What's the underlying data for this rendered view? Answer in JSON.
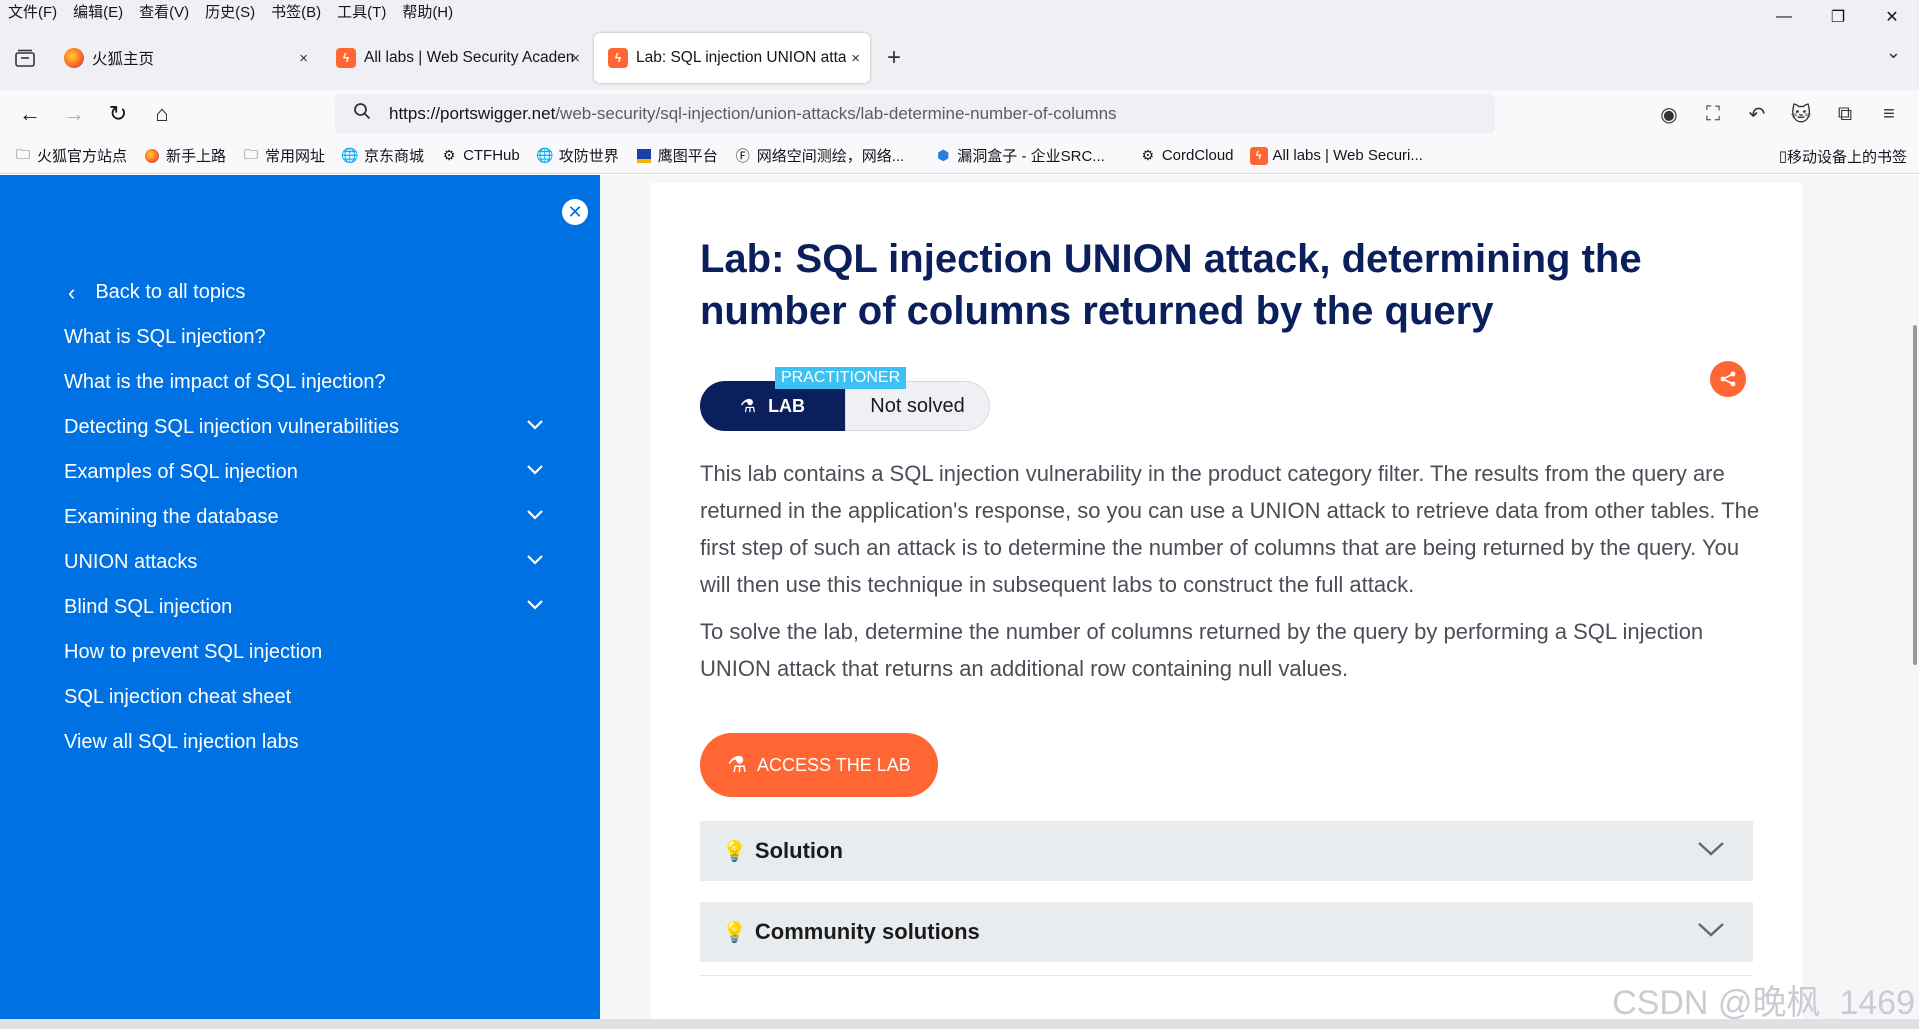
{
  "menubar": {
    "items": [
      "文件(F)",
      "编辑(E)",
      "查看(V)",
      "历史(S)",
      "书签(B)",
      "工具(T)",
      "帮助(H)"
    ]
  },
  "tabs": [
    {
      "label": "火狐主页",
      "close": "×"
    },
    {
      "label": "All labs | Web Security Academ",
      "close": "×"
    },
    {
      "label": "Lab: SQL injection UNION atta",
      "close": "×"
    }
  ],
  "navbar": {
    "url_host": "https://portswigger.net",
    "url_path": "/web-security/sql-injection/union-attacks/lab-determine-number-of-columns"
  },
  "bookmarks": [
    {
      "label": "火狐官方站点",
      "icon": "folder-icon"
    },
    {
      "label": "新手上路",
      "icon": "firefox-icon"
    },
    {
      "label": "常用网址",
      "icon": "folder-icon"
    },
    {
      "label": "京东商城",
      "icon": "globe-icon"
    },
    {
      "label": "CTFHub",
      "icon": "ctfhub-icon"
    },
    {
      "label": "攻防世界",
      "icon": "globe-icon"
    },
    {
      "label": "鹰图平台",
      "icon": "hunter-icon"
    },
    {
      "label": "网络空间测绘，网络...",
      "icon": "fofa-icon"
    },
    {
      "label": "漏洞盒子 - 企业SRC...",
      "icon": "vulbox-icon"
    },
    {
      "label": "CordCloud",
      "icon": "cordcloud-icon"
    },
    {
      "label": "All labs | Web Securi...",
      "icon": "portswigger-icon"
    }
  ],
  "bookmarks_mobile": "移动设备上的书签",
  "sidebar": {
    "back": "Back to all topics",
    "items": [
      {
        "label": "What is SQL injection?",
        "expandable": false
      },
      {
        "label": "What is the impact of SQL injection?",
        "expandable": false
      },
      {
        "label": "Detecting SQL injection vulnerabilities",
        "expandable": true
      },
      {
        "label": "Examples of SQL injection",
        "expandable": true
      },
      {
        "label": "Examining the database",
        "expandable": true
      },
      {
        "label": "UNION attacks",
        "expandable": true
      },
      {
        "label": "Blind SQL injection",
        "expandable": true
      },
      {
        "label": "How to prevent SQL injection",
        "expandable": false
      },
      {
        "label": "SQL injection cheat sheet",
        "expandable": false
      },
      {
        "label": "View all SQL injection labs",
        "expandable": false
      }
    ]
  },
  "lab": {
    "title": "Lab: SQL injection UNION attack, determining the number of columns returned by the query",
    "level": "PRACTITIONER",
    "badge": "LAB",
    "status": "Not solved",
    "description": [
      "This lab contains a SQL injection vulnerability in the product category filter. The results from the query are returned in the application's response, so you can use a UNION attack to retrieve data from other tables. The first step of such an attack is to determine the number of columns that are being returned by the query. You will then use this technique in subsequent labs to construct the full attack.",
      "To solve the lab, determine the number of columns returned by the query by performing a SQL injection UNION attack that returns an additional row containing null values."
    ],
    "access_button": "ACCESS THE LAB",
    "accordions": [
      "Solution",
      "Community solutions"
    ]
  },
  "watermark": "CSDN @晚枫_1469",
  "colors": {
    "sidebar": "#0071e3",
    "accent": "#ff6633",
    "title": "#0a1f5c",
    "level_badge": "#3dc1f3"
  }
}
